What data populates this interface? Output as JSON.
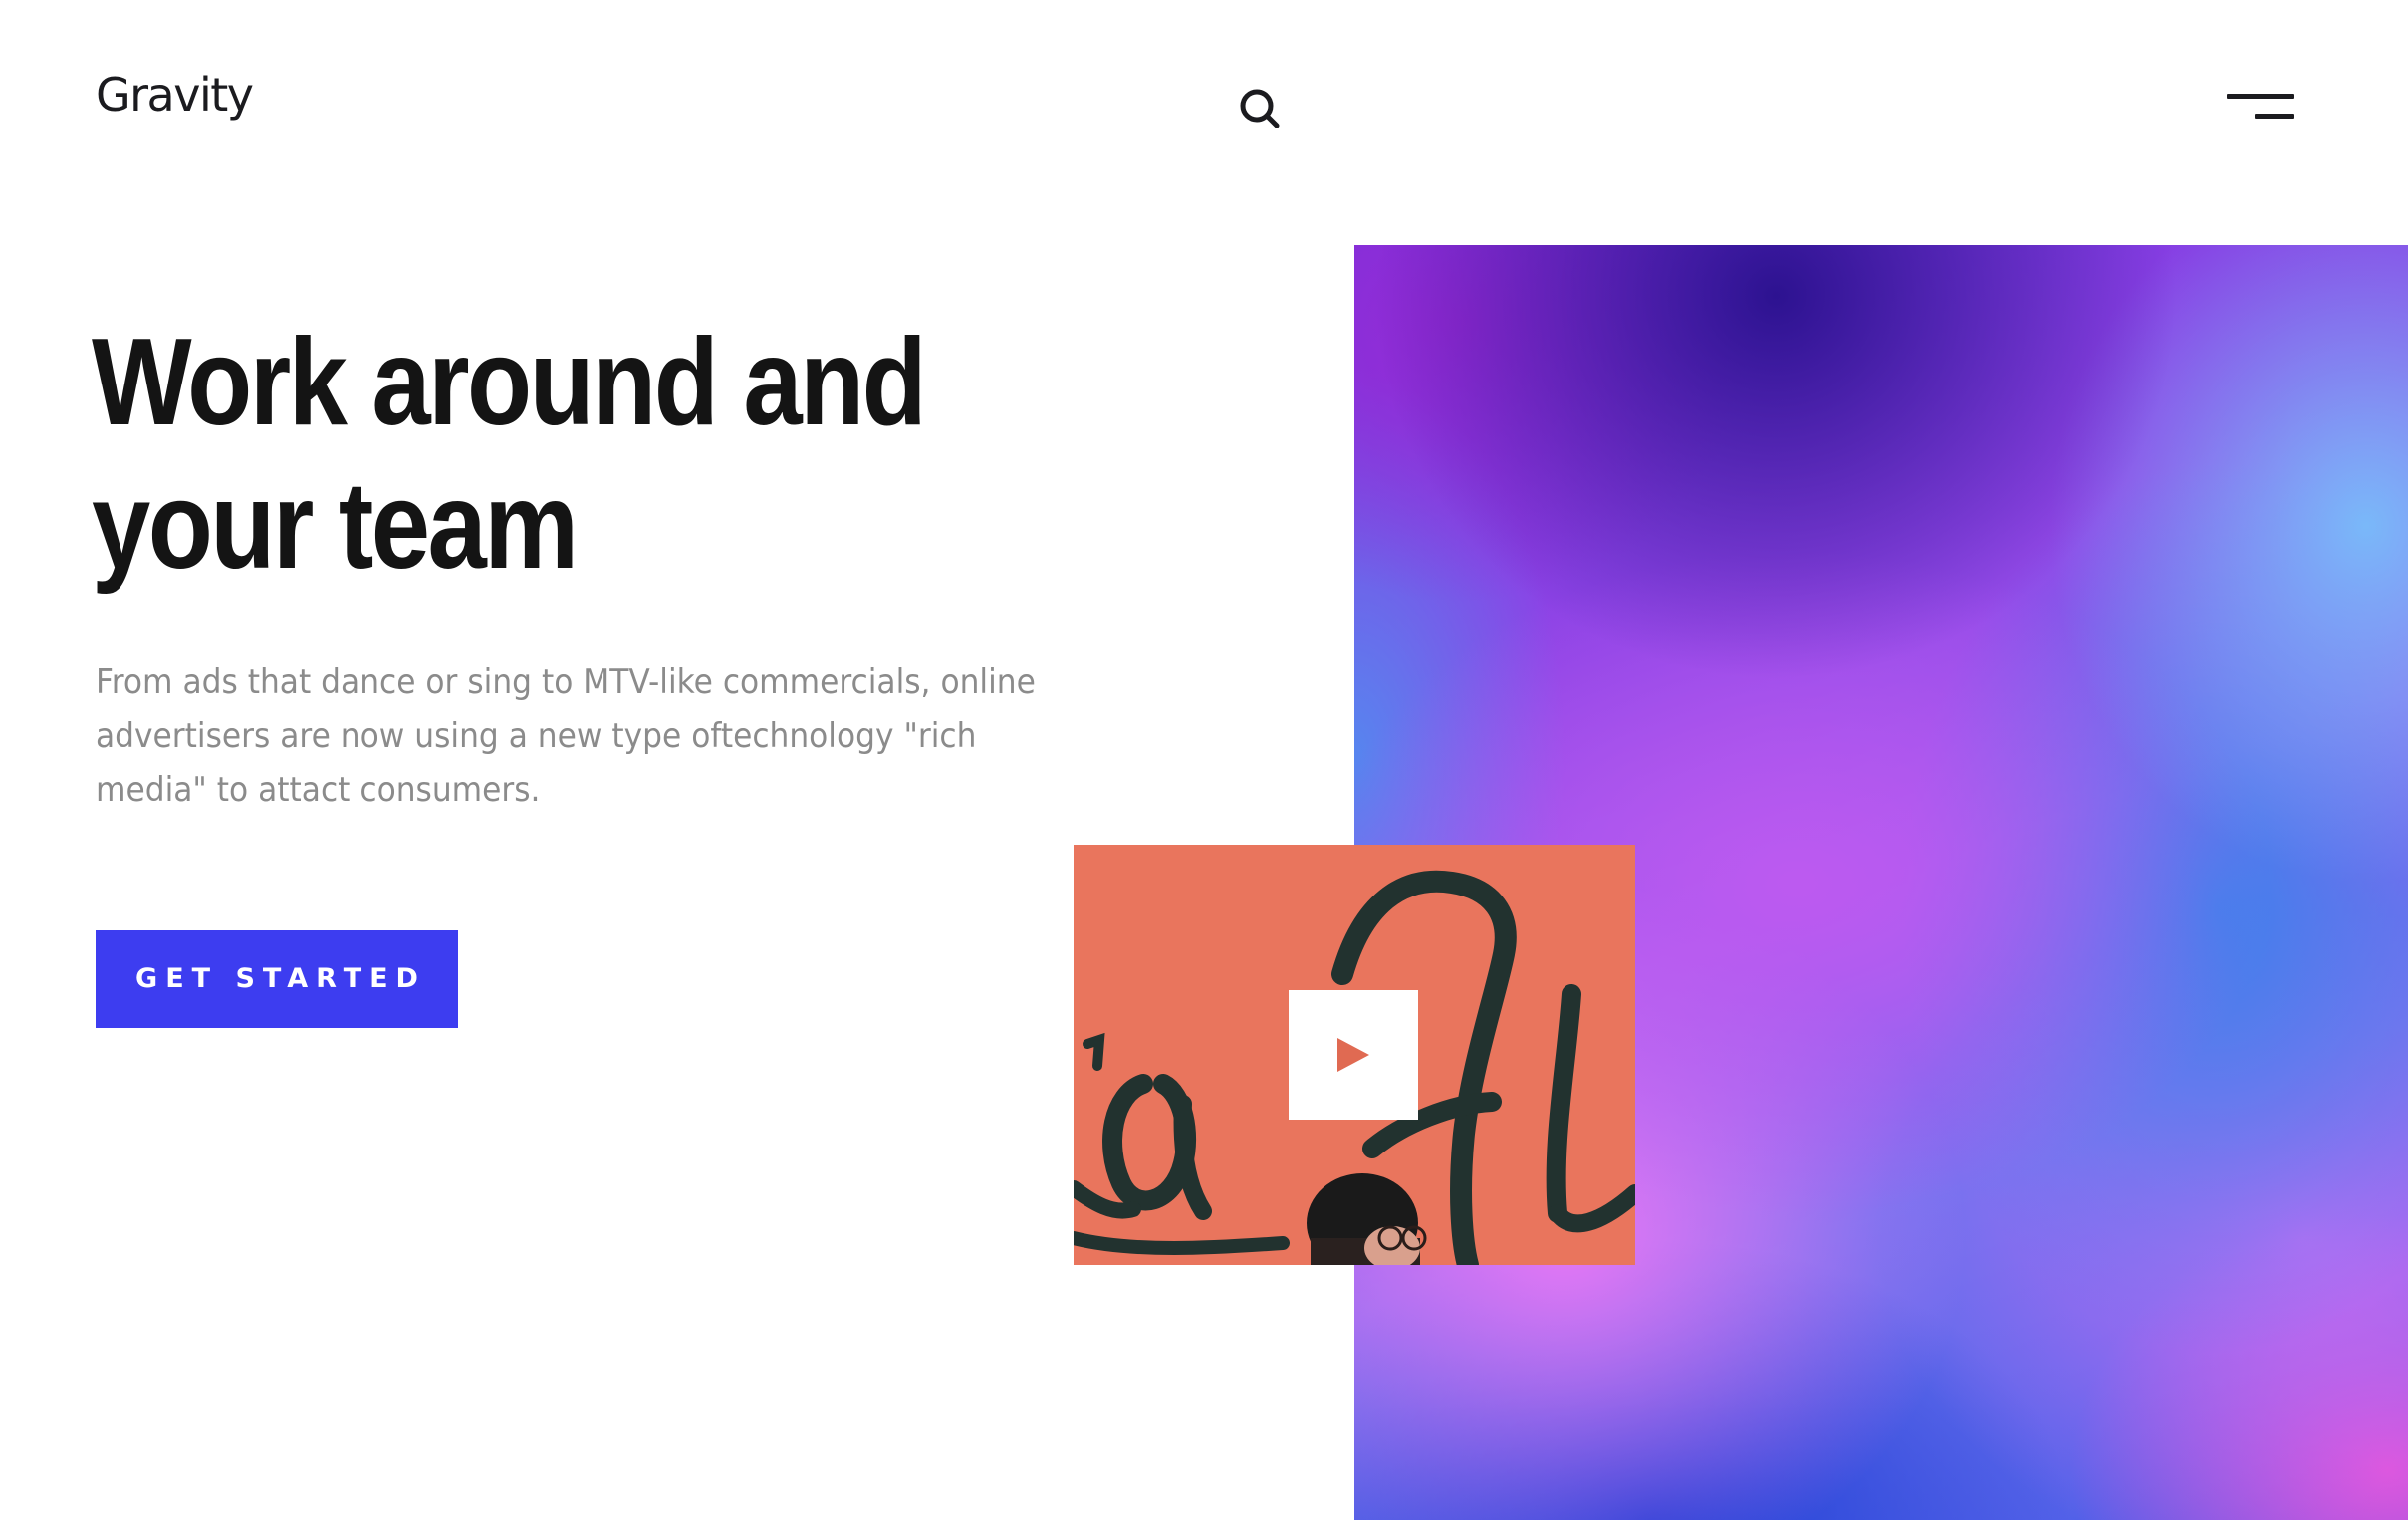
{
  "header": {
    "logo_text": "Gravity",
    "search_icon": "search-icon",
    "menu_icon": "menu-icon"
  },
  "hero": {
    "title_line1": "Work around and",
    "title_line2": "your team",
    "description": "From ads that dance or sing to MTV-like commercials, online advertisers are now using a new type oftechnology \"rich media\" to attact consumers.",
    "cta_label": "GET STARTED"
  },
  "media": {
    "play_icon": "play-icon"
  },
  "colors": {
    "accent": "#3d3df0",
    "heading": "#141414",
    "body_text": "#8b8b8b",
    "thumbnail_bg": "#e76e58",
    "play_triangle": "#e06a52"
  }
}
